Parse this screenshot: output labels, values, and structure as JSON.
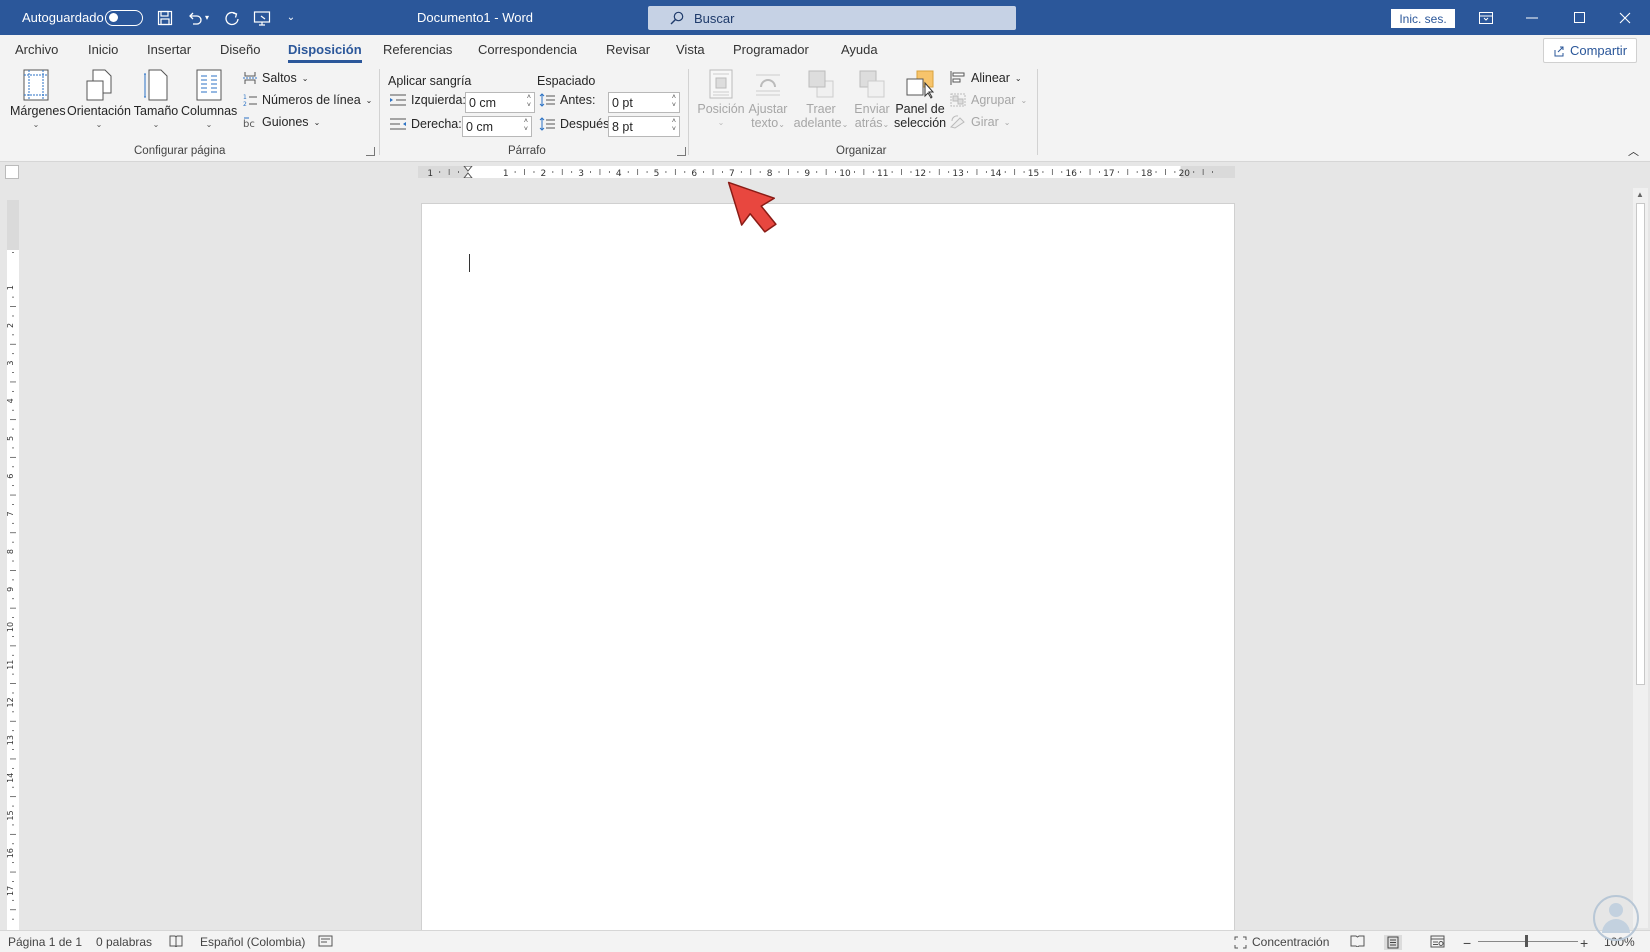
{
  "titlebar": {
    "autosave_label": "Autoguardado",
    "doc_title": "Documento1 - Word",
    "search_placeholder": "Buscar",
    "signin_label": "Inic. ses."
  },
  "tabs": [
    {
      "label": "Archivo"
    },
    {
      "label": "Inicio"
    },
    {
      "label": "Insertar"
    },
    {
      "label": "Diseño"
    },
    {
      "label": "Disposición",
      "active": true
    },
    {
      "label": "Referencias"
    },
    {
      "label": "Correspondencia"
    },
    {
      "label": "Revisar"
    },
    {
      "label": "Vista"
    },
    {
      "label": "Programador"
    },
    {
      "label": "Ayuda"
    }
  ],
  "share_label": "Compartir",
  "ribbon": {
    "page_setup": {
      "margins": "Márgenes",
      "orientation": "Orientación",
      "size": "Tamaño",
      "columns": "Columnas",
      "breaks": "Saltos",
      "line_numbers": "Números de línea",
      "hyphenation": "Guiones",
      "group_label": "Configurar página"
    },
    "paragraph": {
      "indent_header": "Aplicar sangría",
      "spacing_header": "Espaciado",
      "left_label": "Izquierda:",
      "left_value": "0 cm",
      "right_label": "Derecha:",
      "right_value": "0 cm",
      "before_label": "Antes:",
      "before_value": "0 pt",
      "after_label": "Después:",
      "after_value": "8 pt",
      "group_label": "Párrafo"
    },
    "arrange": {
      "position_line1": "Posición",
      "wrap_line1": "Ajustar",
      "wrap_line2": "texto",
      "forward_line1": "Traer",
      "forward_line2": "adelante",
      "backward_line1": "Enviar",
      "backward_line2": "atrás",
      "pane_line1": "Panel de",
      "pane_line2": "selección",
      "align": "Alinear",
      "group": "Agrupar",
      "rotate": "Girar",
      "group_label": "Organizar"
    }
  },
  "hruler_numbers": [
    "1",
    "1",
    "2",
    "3",
    "4",
    "5",
    "6",
    "7",
    "8",
    "9",
    "10",
    "11",
    "12",
    "13",
    "14",
    "15",
    "16",
    "17",
    "18",
    "20"
  ],
  "vruler_numbers": [
    "1",
    "1",
    "2",
    "3",
    "4",
    "5",
    "6",
    "7",
    "8",
    "9",
    "10",
    "11",
    "12",
    "13",
    "14",
    "15",
    "16",
    "17"
  ],
  "statusbar": {
    "page": "Página 1 de 1",
    "words": "0 palabras",
    "language": "Español (Colombia)",
    "focus": "Concentración",
    "zoom": "100%"
  },
  "colors": {
    "title_bar": "#2b579a",
    "ribbon_bg": "#f3f3f3",
    "annotation_arrow": "#e8473f"
  }
}
